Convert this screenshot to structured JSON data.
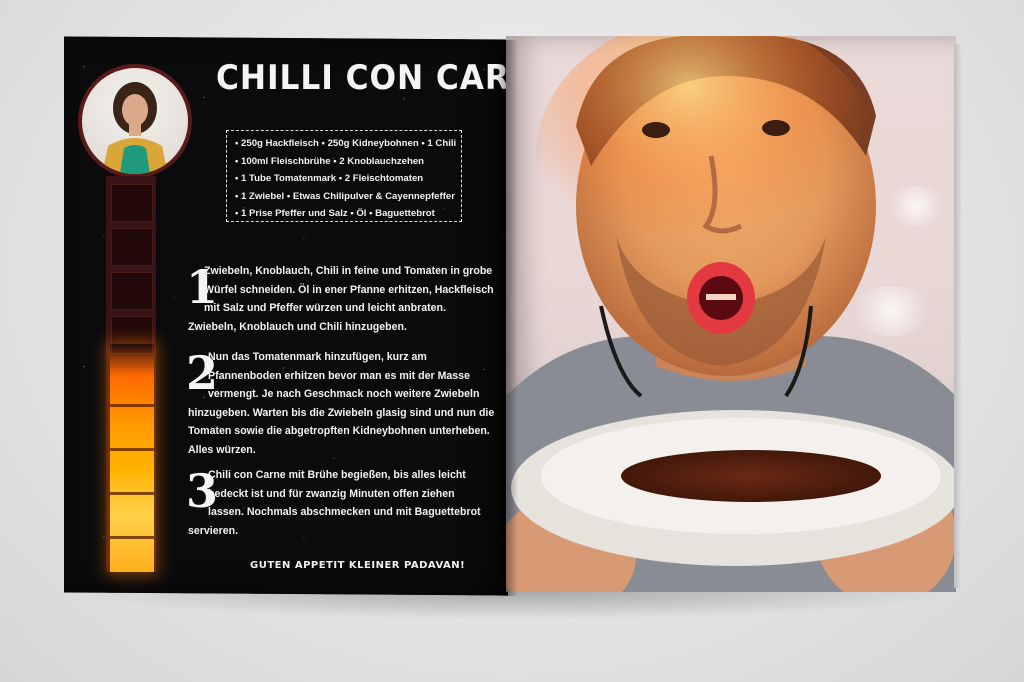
{
  "recipe": {
    "title": "CHILLI CON CARNE",
    "ingredients": [
      "• 250g Hackfleisch • 250g Kidneybohnen • 1 Chili",
      "• 100ml Fleischbrühe • 2 Knoblauchzehen",
      "• 1 Tube Tomatenmark • 2 Fleischtomaten",
      "• 1 Zwiebel • Etwas Chilipulver & Cayennepfeffer",
      "• 1 Prise Pfeffer und Salz • Öl • Baguettebrot"
    ],
    "steps": [
      {
        "number": "1",
        "lines": [
          "Zwiebeln, Knoblauch, Chili in feine und Tomaten in grobe",
          "Würfel schneiden. Öl in ener Pfanne erhitzen, Hackfleisch",
          "mit Salz und Pfeffer würzen und leicht anbraten.",
          "Zwiebeln, Knoblauch und Chili hinzugeben."
        ]
      },
      {
        "number": "2",
        "lines": [
          "Nun das Tomatenmark hinzufügen, kurz am",
          "Pfannenboden erhitzen bevor man es mit der Masse",
          "vermengt. Je nach Geschmack noch weitere Zwiebeln",
          "hinzugeben. Warten bis die Zwiebeln glasig sind und nun die",
          "Tomaten sowie die abgetropften Kidneybohnen unterheben.",
          "Alles würzen."
        ]
      },
      {
        "number": "3",
        "lines": [
          "Chili con Carne mit Brühe begießen, bis alles leicht",
          "bedeckt ist und für zwanzig Minuten offen ziehen",
          "lassen. Nochmals abschmecken und mit Baguettebrot",
          "servieren."
        ]
      }
    ],
    "closing": "GUTEN APPETIT KLEINER PADAVAN!"
  },
  "colors": {
    "page_left_bg": "#0b0b0d",
    "text": "#f2f2f2",
    "portrait_ring": "#5b1a1a",
    "flame": "#ff9900"
  }
}
